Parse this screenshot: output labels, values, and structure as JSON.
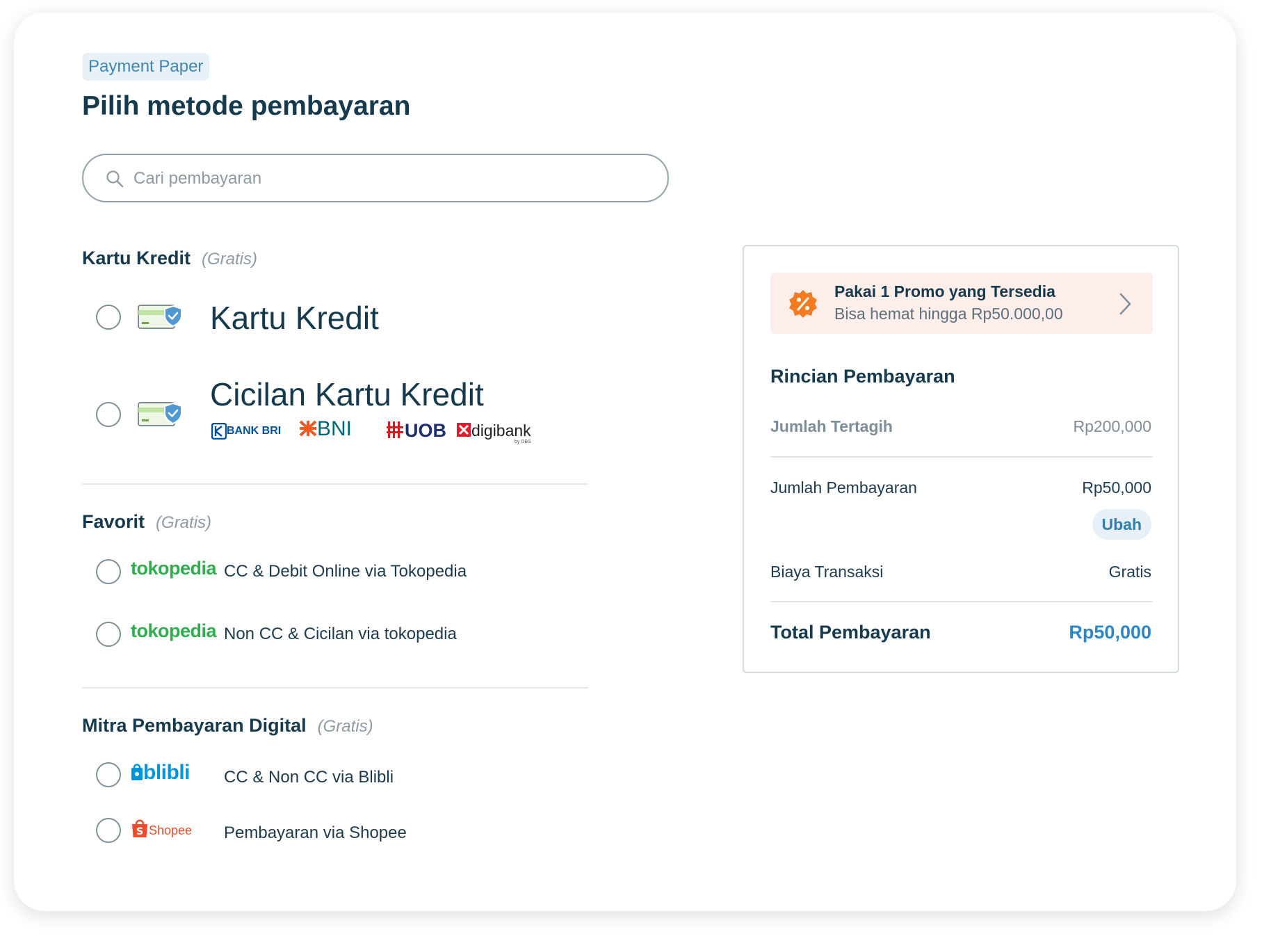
{
  "header": {
    "badge": "Payment Paper",
    "title": "Pilih metode pembayaran"
  },
  "search": {
    "placeholder": "Cari pembayaran",
    "value": ""
  },
  "sections": {
    "kartu_kredit": {
      "title": "Kartu Kredit",
      "fee": "(Gratis)",
      "options": [
        {
          "label": "Kartu Kredit"
        },
        {
          "label": "Cicilan Kartu Kredit",
          "banks": [
            "BANK BRI",
            "BNI",
            "UOB",
            "digibank"
          ],
          "bank_sub": "by DBS"
        }
      ]
    },
    "favorit": {
      "title": "Favorit",
      "fee": "(Gratis)",
      "options": [
        {
          "brand": "tokopedia",
          "label": "CC & Debit Online via Tokopedia"
        },
        {
          "brand": "tokopedia",
          "label": "Non CC & Cicilan via tokopedia"
        }
      ]
    },
    "mitra": {
      "title": "Mitra Pembayaran Digital",
      "fee": "(Gratis)",
      "options": [
        {
          "brand": "blibli",
          "label": "CC & Non CC via Blibli"
        },
        {
          "brand": "Shopee",
          "label": "Pembayaran via Shopee"
        }
      ]
    }
  },
  "summary": {
    "promo": {
      "title": "Pakai 1 Promo yang Tersedia",
      "subtitle": "Bisa hemat hingga Rp50.000,00"
    },
    "title": "Rincian Pembayaran",
    "rows": {
      "tertagih_label": "Jumlah Tertagih",
      "tertagih_value": "Rp200,000",
      "pembayaran_label": "Jumlah Pembayaran",
      "pembayaran_value": "Rp50,000",
      "ubah_label": "Ubah",
      "biaya_label": "Biaya Transaksi",
      "biaya_value": "Gratis",
      "total_label": "Total Pembayaran",
      "total_value": "Rp50,000"
    }
  },
  "colors": {
    "primary_text": "#163a4d",
    "accent_blue": "#2f86c6",
    "tokopedia_green": "#2fae4e",
    "promo_bg": "#fdeeea",
    "promo_icon": "#f47b20",
    "shopee_orange": "#ee4d2d",
    "blibli_blue": "#0095da"
  },
  "icons": [
    "search-icon",
    "credit-card-shield-icon",
    "promo-percent-icon",
    "chevron-right-icon",
    "shopee-bag-icon",
    "blibli-bag-icon"
  ]
}
